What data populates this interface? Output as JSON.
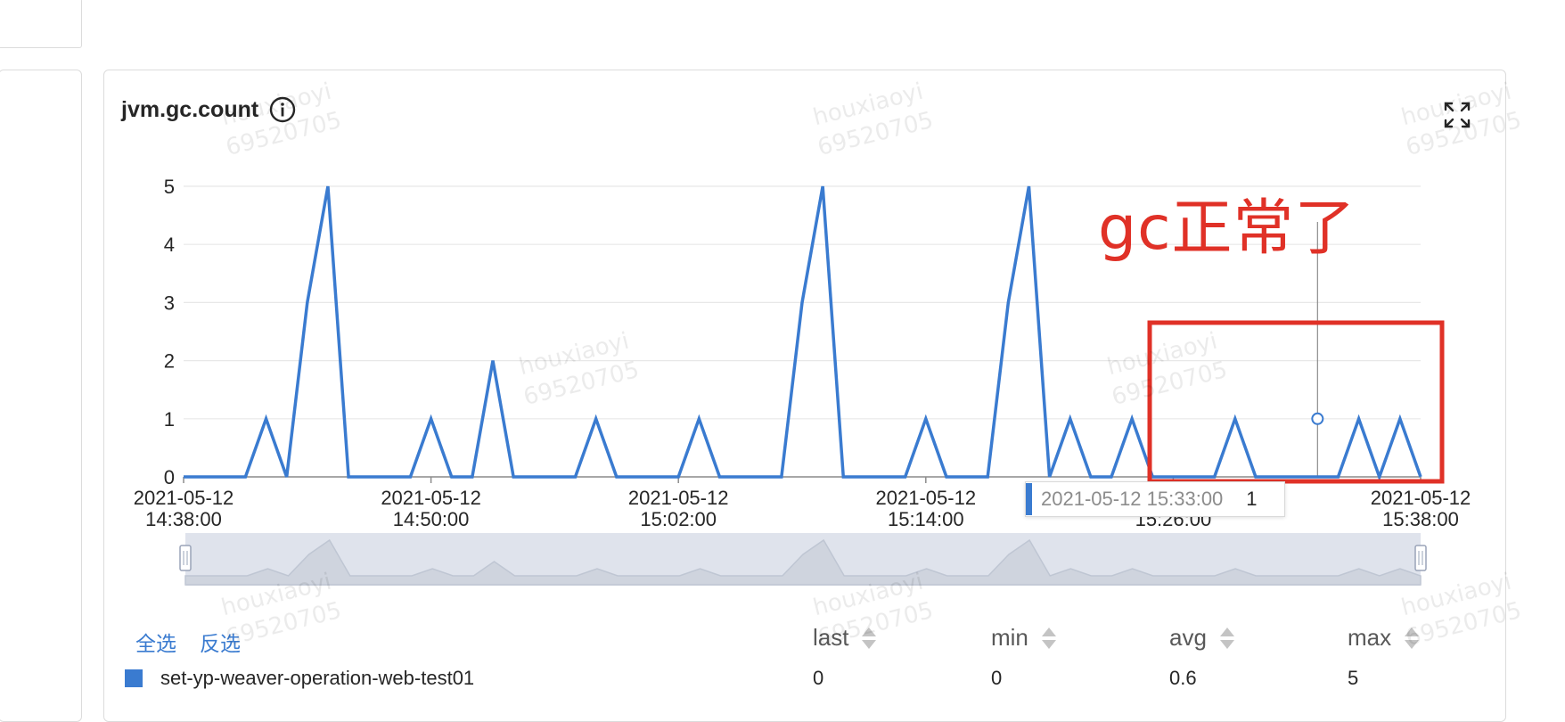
{
  "widget": {
    "title": "jvm.gc.count"
  },
  "chart_data": {
    "type": "line",
    "ylim": [
      0,
      5
    ],
    "yticks": [
      "0",
      "1",
      "2",
      "3",
      "4",
      "5"
    ],
    "xlim": [
      "2021-05-12 14:38:00",
      "2021-05-12 15:38:00"
    ],
    "xticks": [
      {
        "date": "2021-05-12",
        "time": "14:38:00",
        "minute": 0
      },
      {
        "date": "2021-05-12",
        "time": "14:50:00",
        "minute": 12
      },
      {
        "date": "2021-05-12",
        "time": "15:02:00",
        "minute": 24
      },
      {
        "date": "2021-05-12",
        "time": "15:14:00",
        "minute": 36
      },
      {
        "date": "2021-05-12",
        "time": "15:26:00",
        "minute": 48
      },
      {
        "date": "2021-05-12",
        "time": "15:38:00",
        "minute": 60
      }
    ],
    "series": [
      {
        "name": "set-yp-weaver-operation-web-test01",
        "color": "#3a7bd0",
        "x": [
          0,
          1,
          2,
          3,
          4,
          5,
          6,
          7,
          8,
          9,
          10,
          11,
          12,
          13,
          14,
          15,
          16,
          17,
          18,
          19,
          20,
          21,
          22,
          23,
          24,
          25,
          26,
          27,
          28,
          29,
          30,
          31,
          32,
          33,
          34,
          35,
          36,
          37,
          38,
          39,
          40,
          41,
          42,
          43,
          44,
          45,
          46,
          47,
          48,
          49,
          50,
          51,
          52,
          53,
          54,
          55,
          56,
          57,
          58,
          59,
          60
        ],
        "values": [
          0,
          0,
          0,
          0,
          1,
          0,
          3,
          5,
          0,
          0,
          0,
          0,
          1,
          0,
          0,
          2,
          0,
          0,
          0,
          0,
          1,
          0,
          0,
          0,
          0,
          1,
          0,
          0,
          0,
          0,
          3,
          5,
          0,
          0,
          0,
          0,
          1,
          0,
          0,
          0,
          3,
          5,
          0,
          1,
          0,
          0,
          1,
          0,
          0,
          0,
          0,
          1,
          0,
          0,
          0,
          0,
          0,
          1,
          0,
          1,
          0
        ]
      }
    ],
    "grid": true,
    "highlight_point": {
      "x": 55,
      "y": 1
    }
  },
  "annotation": {
    "text": "gc正常了",
    "color": "#e03127"
  },
  "tooltip": {
    "time": "2021-05-12 15:33:00",
    "value": "1"
  },
  "legend": {
    "select_all": "全选",
    "invert": "反选",
    "columns": [
      "last",
      "min",
      "avg",
      "max"
    ],
    "rows": [
      {
        "name": "set-yp-weaver-operation-web-test01",
        "last": "0",
        "min": "0",
        "avg": "0.6",
        "max": "5"
      }
    ]
  },
  "watermarks": [
    [
      "houxiaoyi",
      "69520705"
    ]
  ]
}
